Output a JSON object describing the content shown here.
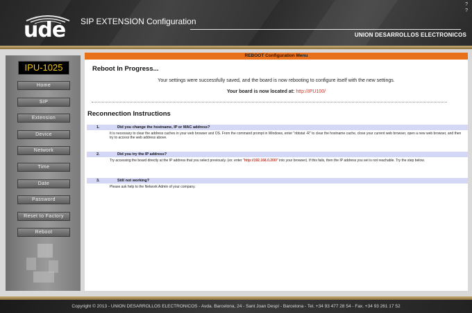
{
  "header": {
    "logo_text": "ude",
    "app_title": "SIP EXTENSION Configuration",
    "company": "UNION DESARROLLOS ELECTRONICOS",
    "help_marks": [
      "?",
      "?"
    ]
  },
  "sidebar": {
    "device_id": "IPU-1025",
    "items": [
      {
        "label": "Home"
      },
      {
        "label": "SIP"
      },
      {
        "label": "Extension"
      },
      {
        "label": "Device"
      },
      {
        "label": "Network"
      },
      {
        "label": "Time"
      },
      {
        "label": "Date"
      },
      {
        "label": "Password"
      },
      {
        "label": "Reset to Factory"
      },
      {
        "label": "Reboot"
      }
    ]
  },
  "main": {
    "panel_title": "REBOOT Configuration Menu",
    "progress_heading": "Reboot In Progress...",
    "saved_message": "Your settings were successfully saved, and the board is now rebooting to configure itself with the new settings.",
    "location_label": "Your board is now located at:",
    "location_url": "http://IPU100/",
    "reconnect_heading": "Reconnection Instructions",
    "steps": [
      {
        "num": "1.",
        "question": "Did you change the hostname, IP or MAC address?",
        "body": "It is necessary to clear the address caches in your web browser and OS. From the command prompt in Windows, enter \"nbtstat -R\" to clear the hostname cache, close your current web browser, open a new web browser, and then try to access the web address above."
      },
      {
        "num": "2.",
        "question": "Did you try the IP address?",
        "body_pre": "Try accessing the board directly at the IP address that you select previously. (ex: enter \"",
        "body_ip": "http://192.168.0.200/",
        "body_post": "\" into your browser). If this fails, then the IP address you set is not reachable. Try the step below."
      },
      {
        "num": "3.",
        "question": "Still not working?",
        "body": "Please ask help to the Network Admin of your company."
      }
    ]
  },
  "footer": {
    "copyright": "Copyright  © 2013 - UNION DESARROLLOS ELECTRONICOS  -  Avda. Barcelona, 24 - Sant Joan Despí  -  Barcelona  -  Tel. +34 93 477 28 54  -  Fax. +34 93 261 17 52"
  },
  "colors": {
    "accent": "#e8701a",
    "device_id_text": "#f0c419",
    "link": "#c0392b",
    "step_header_bg": "#d4d7f6"
  }
}
